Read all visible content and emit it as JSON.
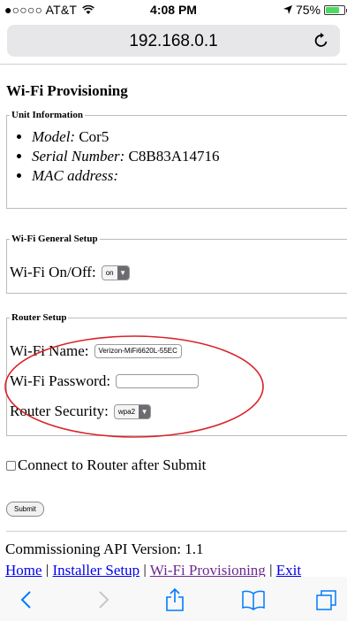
{
  "status": {
    "carrier": "●○○○○ AT&T",
    "time": "4:08 PM",
    "battery": "75%",
    "battery_level": 0.75
  },
  "browser": {
    "url": "192.168.0.1",
    "reload_icon": "reload-icon"
  },
  "page": {
    "title": "Wi-Fi Provisioning",
    "unit_info": {
      "legend": "Unit Information",
      "items": [
        {
          "label": "Model:",
          "value": "Cor5"
        },
        {
          "label": "Serial Number:",
          "value": "C8B83A14716"
        },
        {
          "label": "MAC address:",
          "value": ""
        }
      ]
    },
    "general": {
      "legend": "Wi-Fi General Setup",
      "onoff_label": "Wi-Fi On/Off:",
      "onoff_value": "on"
    },
    "router": {
      "legend": "Router Setup",
      "name_label": "Wi-Fi Name:",
      "name_value": "Verizon-MiFi6620L-55EC",
      "password_label": "Wi-Fi Password:",
      "password_value": "",
      "security_label": "Router Security:",
      "security_value": "wpa2"
    },
    "connect_label": "Connect to Router after Submit",
    "submit_label": "Submit",
    "version": "Commissioning API Version: 1.1",
    "links": {
      "home": "Home",
      "installer": "Installer Setup",
      "wifi": "Wi-Fi Provisioning",
      "exit": "Exit",
      "separator": " | "
    }
  },
  "colors": {
    "link": "#0000ee",
    "visited": "#6c2a8f",
    "annotation": "#d9232a",
    "ios_blue": "#007aff",
    "battery": "#4cd964"
  }
}
